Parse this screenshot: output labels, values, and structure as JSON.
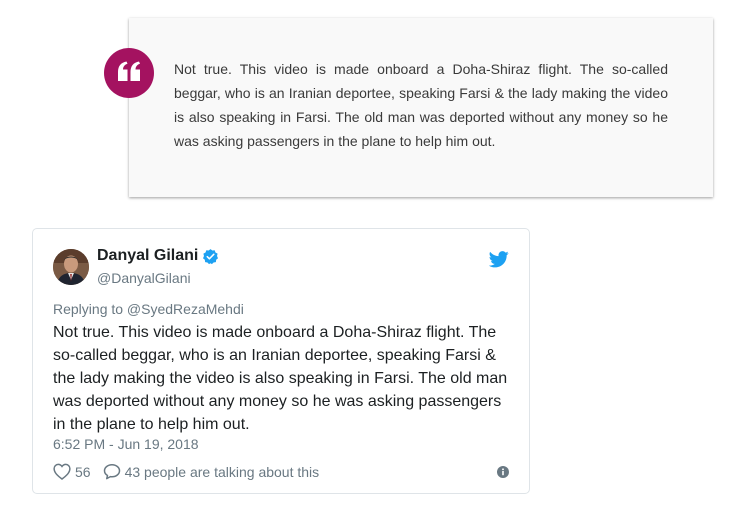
{
  "quote": {
    "icon": "quote-icon",
    "text": "Not true. This video is made onboard a Doha-Shiraz flight. The so-called beggar, who is an Iranian deportee, speaking Farsi & the lady making the video is also speaking in Farsi. The old man was deported without any money so he was asking passengers in the plane to help him out.",
    "accent_color": "#a41260"
  },
  "tweet": {
    "display_name": "Danyal Gilani",
    "handle": "@DanyalGilani",
    "replying_to": "Replying to @SyedRezaMehdi",
    "text": "Not true. This video is made onboard a Doha-Shiraz flight. The so-called beggar, who is an Iranian deportee, speaking Farsi & the lady making the video is also speaking in Farsi. The old man was deported without any money so he was asking passengers in the plane to help him out.",
    "timestamp": "6:52 PM - Jun 19, 2018",
    "likes": "56",
    "talking": "43 people are talking about this",
    "brand_color": "#1da1f2"
  }
}
